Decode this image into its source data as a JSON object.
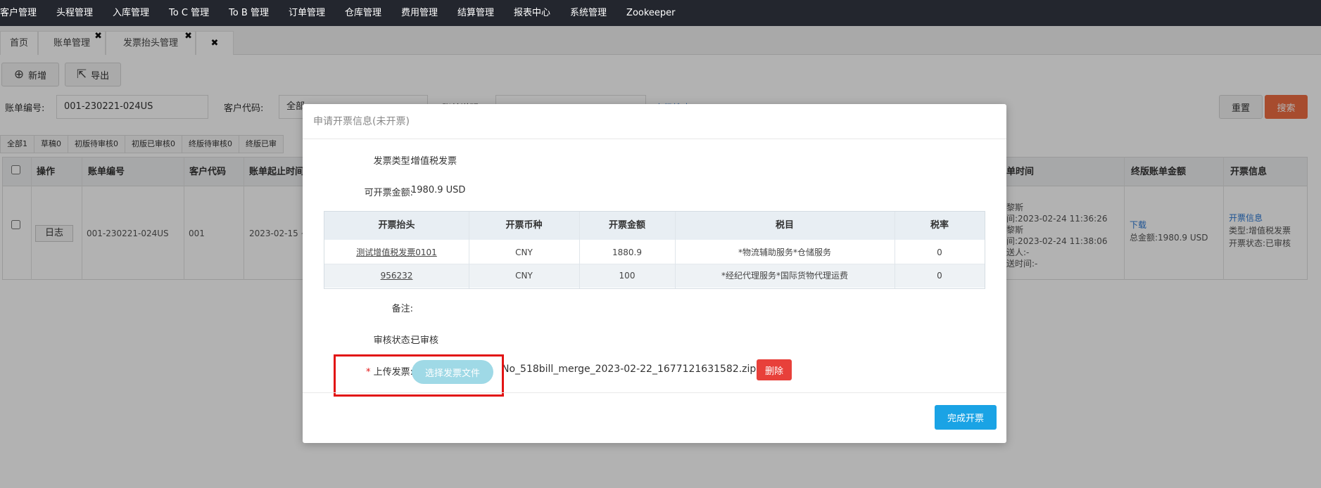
{
  "topnav": {
    "items": [
      "客户管理",
      "头程管理",
      "入库管理",
      "To C 管理",
      "To B 管理",
      "订单管理",
      "仓库管理",
      "费用管理",
      "结算管理",
      "报表中心",
      "系统管理",
      "Zookeeper"
    ]
  },
  "tabs": {
    "home": "首页",
    "billing": "账单管理",
    "invoice_header": "发票抬头管理",
    "close_mark": "✖"
  },
  "toolbar": {
    "add_label": "新增",
    "export_label": "导出"
  },
  "filters": {
    "bill_no_label": "账单编号:",
    "bill_no_value": "001-230221-024US",
    "customer_code_label": "客户代码:",
    "customer_code_value": "全部",
    "bill_desc_label": "账单说明",
    "advanced_search": "高级搜索",
    "reset_label": "重置",
    "search_label": "搜索"
  },
  "status_tabs": [
    "全部1",
    "草稿0",
    "初版待审核0",
    "初版已审核0",
    "终版待审核0",
    "终版已审"
  ],
  "table": {
    "headers": {
      "action": "操作",
      "bill_no": "账单编号",
      "customer_code": "客户代码",
      "period": "账单起止时间",
      "bill_time": "账单时间",
      "final_amount": "终版账单金额",
      "invoice_info": "开票信息"
    },
    "row": {
      "log_button": "日志",
      "bill_no": "001-230221-024US",
      "customer_code": "001",
      "period": "2023-02-15 ~",
      "time_lines": [
        "黎斯",
        "间:2023-02-24 11:36:26",
        "黎斯",
        "间:2023-02-24 11:38:06",
        "送人:-",
        "送时间:-"
      ],
      "download": "下载",
      "total_amount": "总金额:1980.9 USD",
      "invoice_link": "开票信息",
      "invoice_type": "类型:增值税发票",
      "invoice_status": "开票状态:已审核"
    }
  },
  "modal": {
    "title": "申请开票信息(未开票)",
    "invoice_type_label": "发票类型:",
    "invoice_type_value": "增值税发票",
    "amount_label": "可开票金额:",
    "amount_value": "1980.9 USD",
    "table_headers": [
      "开票抬头",
      "开票币种",
      "开票金额",
      "税目",
      "税率"
    ],
    "rows": [
      {
        "header": "测试增值税发票0101",
        "currency": "CNY",
        "amount": "1880.9",
        "item": "*物流辅助服务*仓储服务",
        "rate": "0"
      },
      {
        "header": "956232",
        "currency": "CNY",
        "amount": "100",
        "item": "*经纪代理服务*国际货物代理运费",
        "rate": "0"
      }
    ],
    "remark_label": "备注:",
    "audit_label": "审核状态:",
    "audit_value": "已审核",
    "required_mark": "*",
    "upload_label": "上传发票:",
    "upload_button": "选择发票文件",
    "file_name": "No_518bill_merge_2023-02-22_1677121631582.zip",
    "delete_button": "删除",
    "finish_button": "完成开票"
  },
  "colors": {
    "nav_bg": "#23262e",
    "search_btn": "#ef6e43",
    "delete_btn": "#e8403a",
    "finish_btn": "#1aa3e5",
    "highlight": "#e21414"
  }
}
